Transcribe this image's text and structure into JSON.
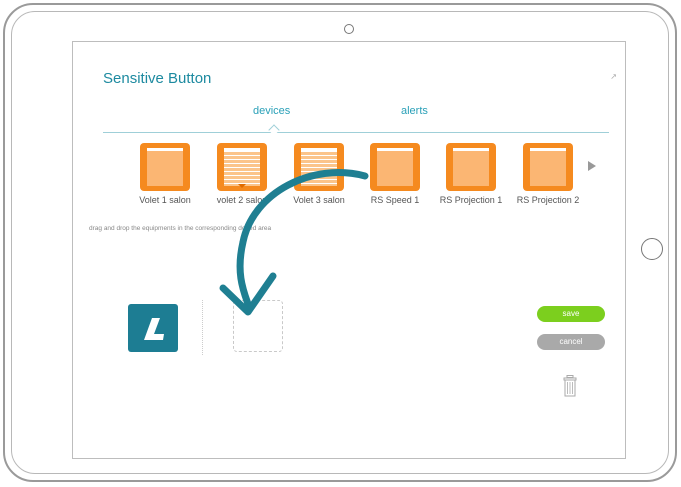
{
  "page": {
    "title": "Sensitive Button",
    "instruction": "drag and drop the equipments in the corresponding dotted area"
  },
  "tabs": [
    {
      "label": "devices",
      "active": true
    },
    {
      "label": "alerts",
      "active": false
    }
  ],
  "devices": [
    {
      "label": "Volet 1 salon",
      "icon": "shutter-icon"
    },
    {
      "label": "volet 2 salon",
      "icon": "shutter-slats-icon"
    },
    {
      "label": "Volet 3 salon",
      "icon": "shutter-slats-icon"
    },
    {
      "label": "RS Speed 1",
      "icon": "shutter-icon"
    },
    {
      "label": "RS Projection 1",
      "icon": "shutter-icon"
    },
    {
      "label": "RS Projection 2",
      "icon": "shutter-icon"
    }
  ],
  "actions": {
    "save_label": "save",
    "cancel_label": "cancel"
  },
  "colors": {
    "accent": "#1d8aa0",
    "device_tile": "#f58a1f",
    "save": "#7ccf1e",
    "cancel": "#a9a9a9",
    "logo": "#1d7d93"
  }
}
